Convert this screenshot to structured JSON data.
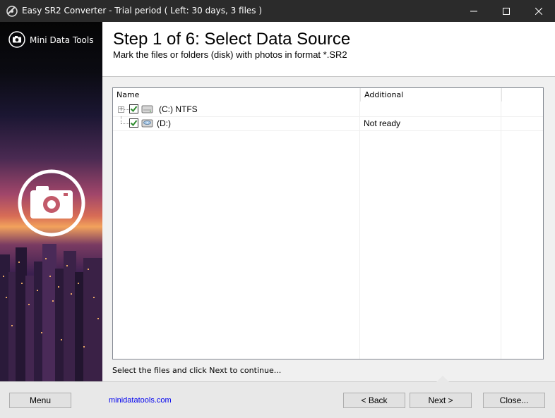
{
  "window": {
    "title": "Easy SR2 Converter - Trial period ( Left: 30 days, 3 files )",
    "minimize_icon": "minimize-icon",
    "maximize_icon": "maximize-icon",
    "close_icon": "close-icon"
  },
  "left_panel": {
    "brand": "Mini Data Tools",
    "brand_icon": "camera-icon"
  },
  "header": {
    "step_title": "Step 1 of 6: Select Data Source",
    "subtitle": "Mark the files or folders (disk) with photos in format *.SR2"
  },
  "tree": {
    "columns": [
      "Name",
      "Additional"
    ],
    "rows": [
      {
        "name": "(C:) NTFS",
        "additional": "",
        "checked": true,
        "expandable": true,
        "icon": "hard-drive-icon"
      },
      {
        "name": "(D:)",
        "additional": "Not ready",
        "checked": true,
        "expandable": false,
        "icon": "optical-drive-icon"
      }
    ]
  },
  "hint": "Select the files and click Next to continue...",
  "footer": {
    "menu_label": "Menu",
    "link": "minidatatools.com",
    "back_label": "< Back",
    "next_label": "Next >",
    "close_label": "Close..."
  },
  "colors": {
    "titlebar": "#2b2b2b",
    "link": "#0000ee",
    "check": "#2e8b2e"
  }
}
